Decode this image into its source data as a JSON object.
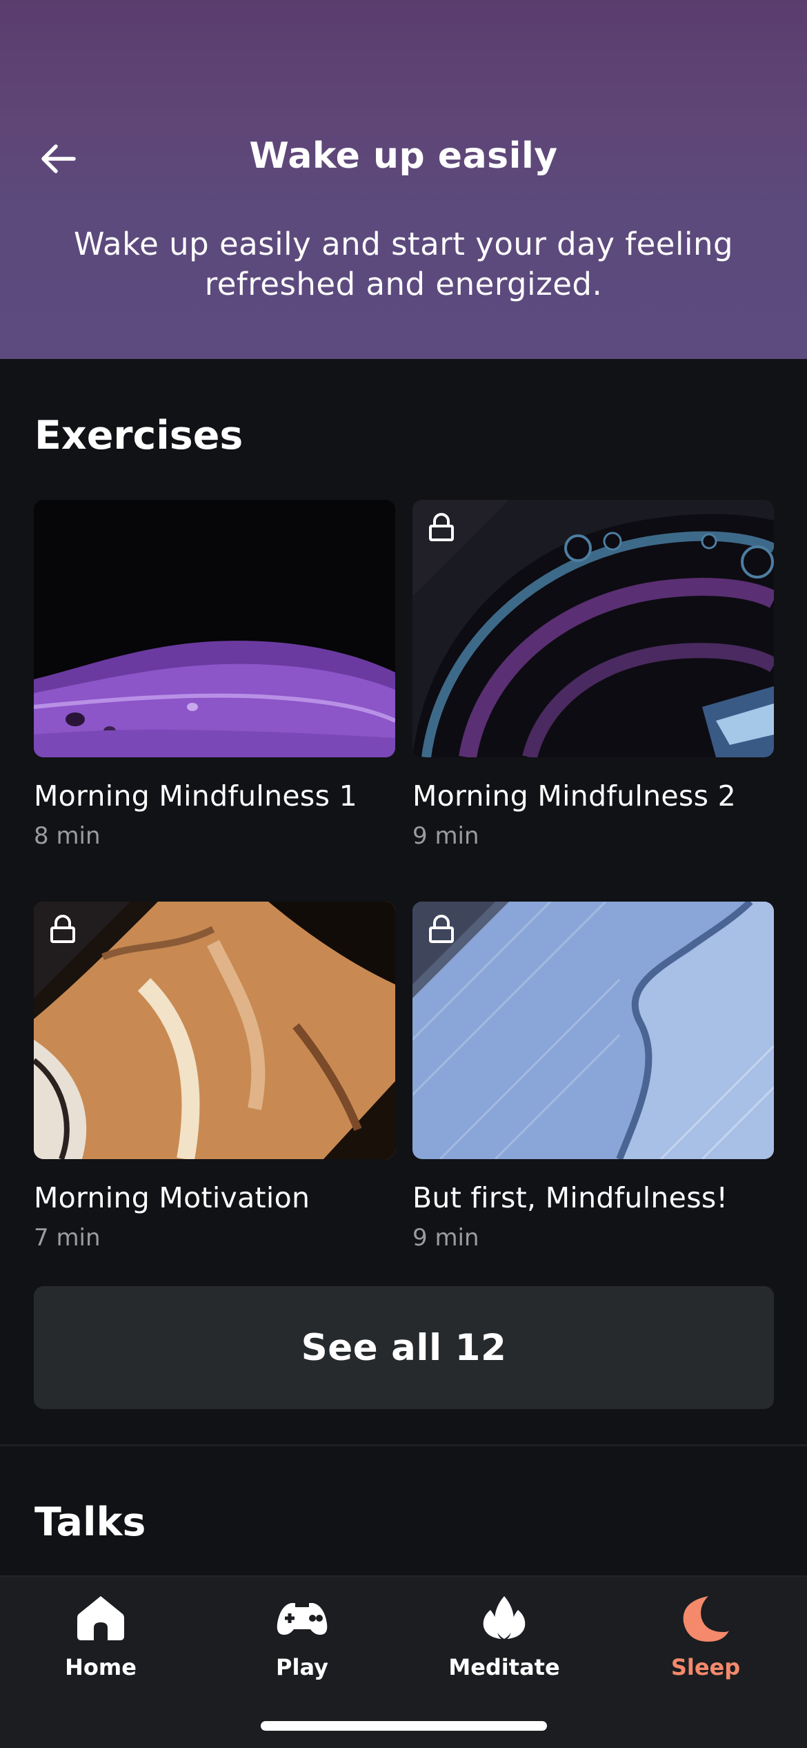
{
  "header": {
    "title": "Wake up easily",
    "description": "Wake up easily and start your day feeling refreshed and energized."
  },
  "exercises": {
    "title": "Exercises",
    "items": [
      {
        "title": "Morning Mindfulness 1",
        "duration": "8 min",
        "locked": false
      },
      {
        "title": "Morning Mindfulness 2",
        "duration": "9 min",
        "locked": true
      },
      {
        "title": "Morning Motivation",
        "duration": "7 min",
        "locked": true
      },
      {
        "title": "But first, Mindfulness!",
        "duration": "9 min",
        "locked": true
      }
    ],
    "see_all_label": "See all 12"
  },
  "talks": {
    "title": "Talks"
  },
  "tabbar": {
    "items": [
      {
        "label": "Home",
        "icon": "home-icon",
        "active": false
      },
      {
        "label": "Play",
        "icon": "gamepad-icon",
        "active": false
      },
      {
        "label": "Meditate",
        "icon": "lotus-icon",
        "active": false
      },
      {
        "label": "Sleep",
        "icon": "moon-icon",
        "active": true
      }
    ],
    "active_color": "#f4896b"
  }
}
